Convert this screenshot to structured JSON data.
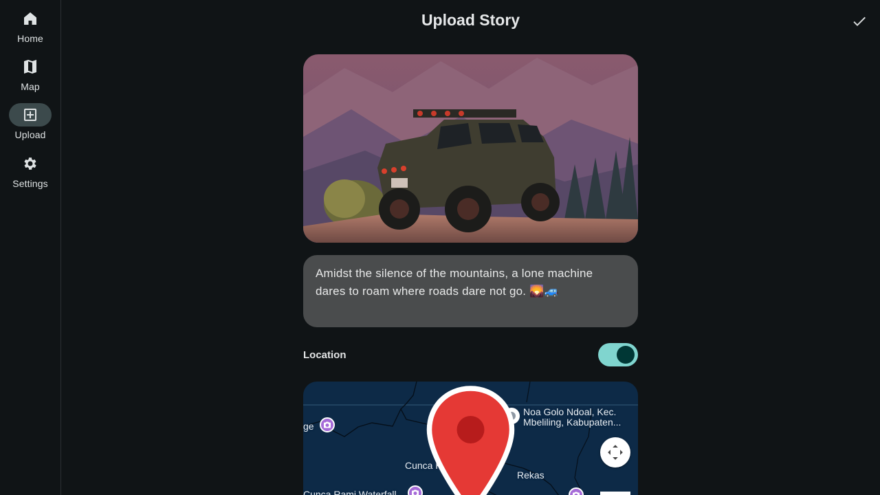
{
  "nav": {
    "items": [
      {
        "id": "home",
        "label": "Home",
        "icon": "home-icon",
        "active": false
      },
      {
        "id": "map",
        "label": "Map",
        "icon": "map-icon",
        "active": false
      },
      {
        "id": "upload",
        "label": "Upload",
        "icon": "add-box-icon",
        "active": true
      },
      {
        "id": "settings",
        "label": "Settings",
        "icon": "gear-icon",
        "active": false
      }
    ]
  },
  "header": {
    "title": "Upload Story",
    "confirm_icon": "check-icon"
  },
  "caption": {
    "text": "Amidst the silence of the mountains, a lone machine dares to roam where roads dare not go. 🌄🚙"
  },
  "location": {
    "label": "Location",
    "enabled": true
  },
  "map": {
    "labels": {
      "left_partial": "ge",
      "noa_golo_line1": "Noa Golo Ndoal, Kec.",
      "noa_golo_line2": "Mbeliling, Kabupaten...",
      "cunca_plias": "Cunca Plias",
      "rekas": "Rekas",
      "waterfall": "Cunca Rami Waterfall"
    }
  },
  "colors": {
    "background": "#101416",
    "nav_active": "#3c4a4c",
    "caption_bg": "#4a4c4d",
    "toggle_track": "#80d5cf",
    "toggle_knob": "#003735",
    "map_water": "#0d2a47",
    "pin_red": "#e53935",
    "poi_purple": "#a66bd8"
  }
}
